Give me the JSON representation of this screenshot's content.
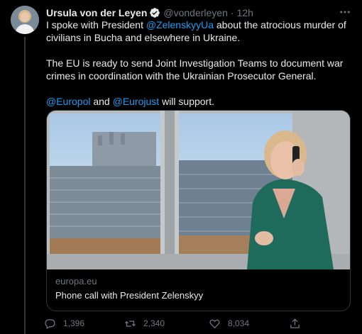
{
  "author": {
    "name": "Ursula von der Leyen",
    "handle": "@vonderleyen",
    "separator": "·",
    "time": "12h"
  },
  "tweet": {
    "p1_a": "I spoke with President ",
    "p1_mention": "@ZelenskyyUa",
    "p1_b": " about the atrocious murder of civilians in Bucha and elsewhere in Ukraine.",
    "p2": "The EU is ready to send Joint Investigation Teams to document war crimes in coordination with the Ukrainian Prosecutor General.",
    "p3_mention1": "@Europol",
    "p3_and": " and ",
    "p3_mention2": "@Eurojust",
    "p3_rest": " will support."
  },
  "card": {
    "domain": "europa.eu",
    "title": "Phone call with President Zelenskyy"
  },
  "actions": {
    "replies": "1,396",
    "retweets": "2,340",
    "likes": "8,034"
  },
  "icons": {
    "verified": "verified-badge-icon",
    "more": "more-options-icon",
    "reply": "reply-icon",
    "retweet": "retweet-icon",
    "like": "heart-icon",
    "share": "share-icon"
  },
  "colors": {
    "background": "#000000",
    "text": "#e7e9ea",
    "secondary": "#71767b",
    "link": "#1d9bf0"
  }
}
